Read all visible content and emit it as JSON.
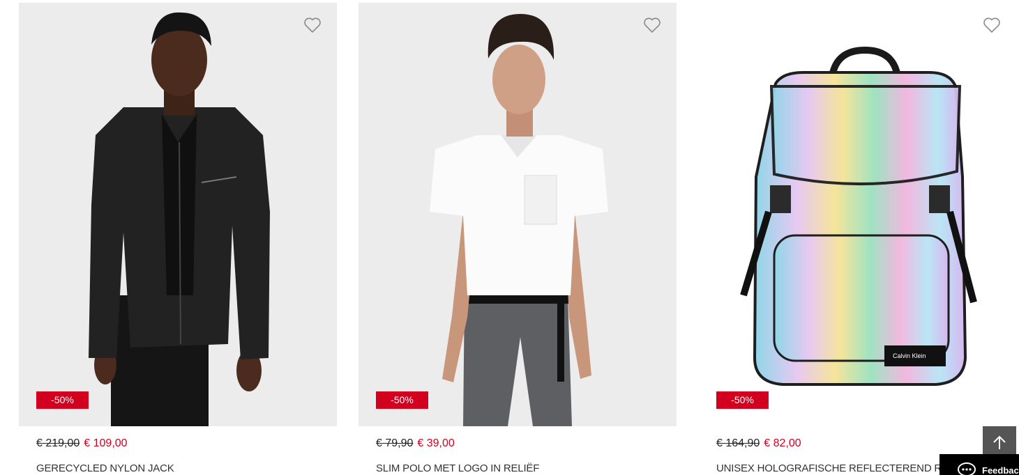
{
  "products": [
    {
      "discount": "-50%",
      "old_price": "€ 219,00",
      "new_price": "€ 109,00",
      "name": "GERECYCLED NYLON JACK"
    },
    {
      "discount": "-50%",
      "old_price": "€ 79,90",
      "new_price": "€ 39,00",
      "name": "SLIM POLO MET LOGO IN RELIËF"
    },
    {
      "discount": "-50%",
      "old_price": "€ 164,90",
      "new_price": "€ 82,00",
      "name": "UNISEX HOLOGRAFISCHE REFLECTEREND RUGZAK M",
      "image_label": "Calvin Klein"
    }
  ],
  "feedback": {
    "label": "Feedback"
  },
  "colors": {
    "sale_red": "#d2001f",
    "image_bg": "#ececec",
    "scroll_button": "#555555"
  },
  "icons": {
    "wishlist": "heart-outline-icon",
    "scroll_top": "arrow-up-icon",
    "feedback": "chat-bubble-icon"
  }
}
